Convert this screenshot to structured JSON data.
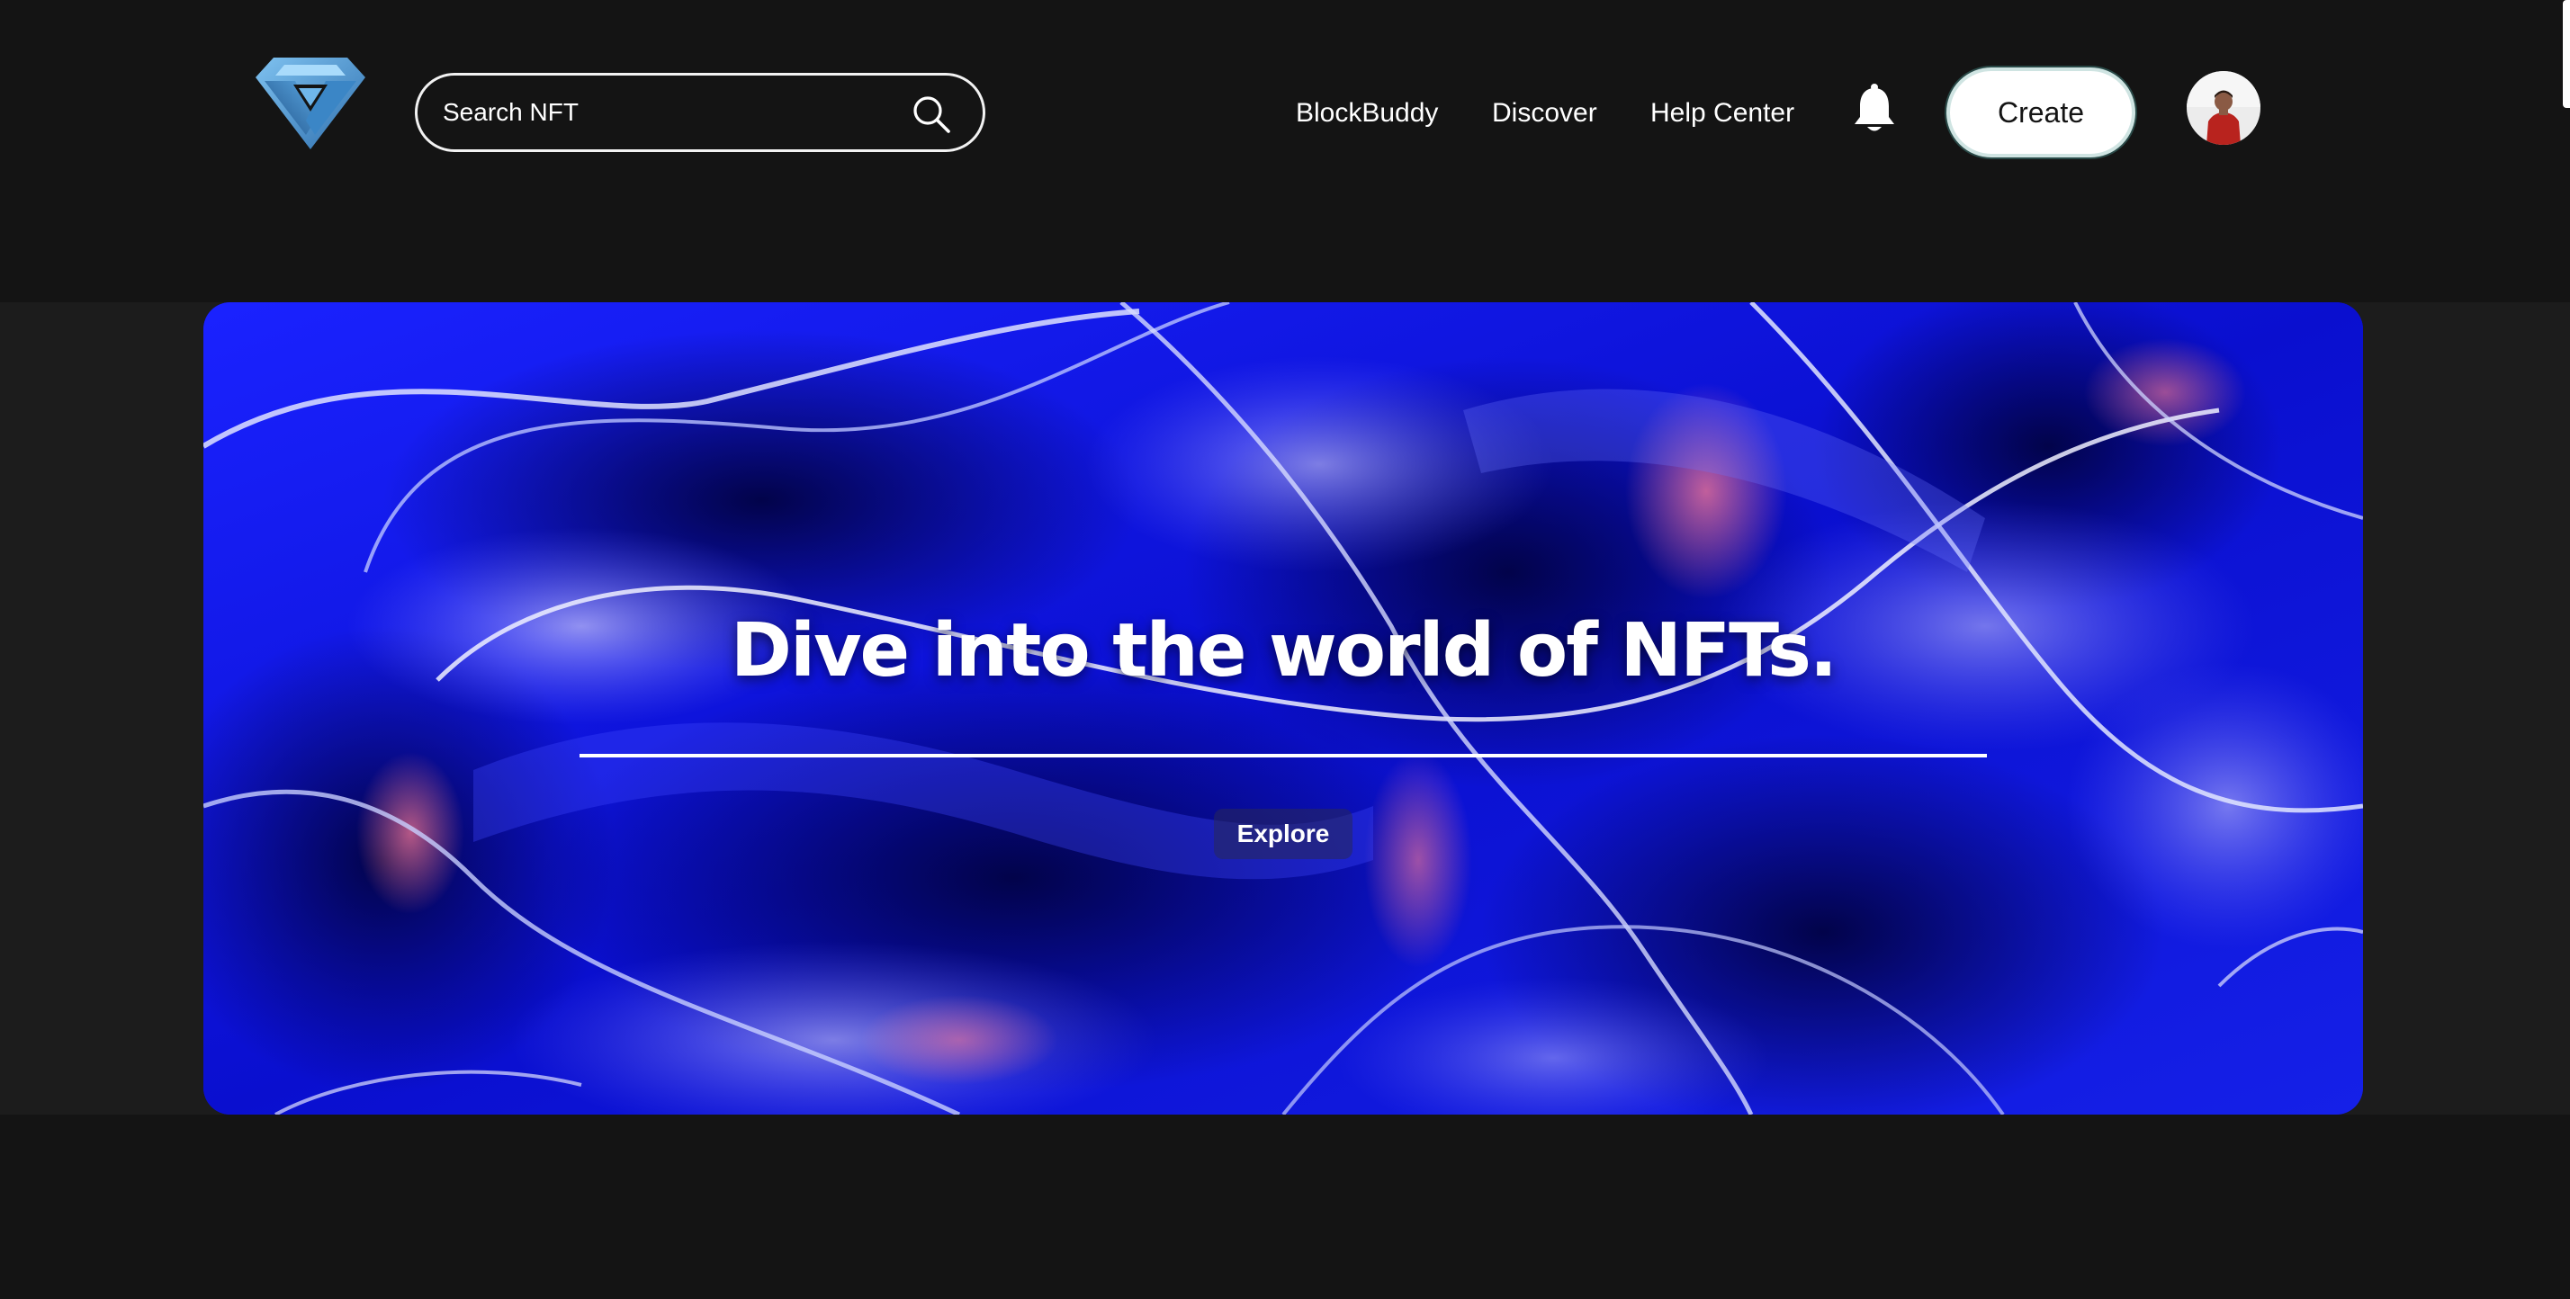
{
  "header": {
    "logo_icon": "triangle-knot-logo",
    "search": {
      "placeholder": "Search NFT",
      "value": "",
      "icon": "search-icon"
    },
    "nav": [
      {
        "label": "BlockBuddy"
      },
      {
        "label": "Discover"
      },
      {
        "label": "Help Center"
      }
    ],
    "notifications_icon": "bell-icon",
    "create_label": "Create",
    "avatar_icon": "user-avatar"
  },
  "hero": {
    "title": "Dive into the world of NFTs.",
    "explore_label": "Explore"
  },
  "colors": {
    "background": "#141414",
    "band": "#1c1c1c",
    "hero_blue": "#0b0fd0",
    "accent_pink": "#ff6a8a",
    "text": "#ffffff"
  }
}
